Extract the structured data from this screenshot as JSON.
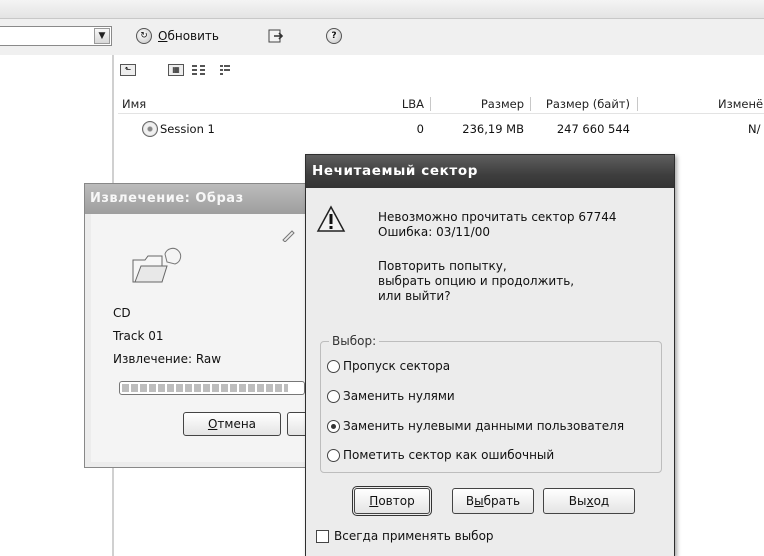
{
  "toolbar": {
    "refresh_label": "Обновить",
    "refresh_accel": "О",
    "refresh_rest": "бновить"
  },
  "file_list": {
    "columns": [
      "Имя",
      "LBA",
      "Размер",
      "Размер (байт)",
      "Изменё"
    ],
    "rows": [
      {
        "name": "Session 1",
        "lba": "0",
        "size": "236,19 MB",
        "size_bytes": "247 660 544",
        "modified": "N/"
      }
    ]
  },
  "extract_window": {
    "title": "Извлечение: Образ",
    "lines": [
      "CD",
      "Track 01",
      "Извлечение: Raw"
    ],
    "progress_fraction": 0.92,
    "cancel_accel": "О",
    "cancel_rest": "тмена"
  },
  "dialog": {
    "title": "Нечитаемый сектор",
    "message_lines": [
      "Невозможно прочитать сектор 67744",
      "Ошибка: 03/11/00"
    ],
    "prompt_lines": [
      "Повторить попытку,",
      "выбрать опцию и продолжить,",
      "или выйти?"
    ],
    "group_label": "Выбор:",
    "options": [
      {
        "label": "Пропуск сектора",
        "selected": false
      },
      {
        "label": "Заменить нулями",
        "selected": false
      },
      {
        "label": "Заменить нулевыми данными пользователя",
        "selected": true
      },
      {
        "label": "Пометить сектор как ошибочный",
        "selected": false
      }
    ],
    "retry": {
      "accel": "П",
      "rest": "овтор"
    },
    "choose": {
      "pre": "В",
      "accel": "ы",
      "rest": "брать"
    },
    "exit": {
      "pre": "Вы",
      "accel": "х",
      "rest": "од"
    },
    "always_apply_label": "Всегда применять выбор",
    "always_apply_checked": false
  }
}
